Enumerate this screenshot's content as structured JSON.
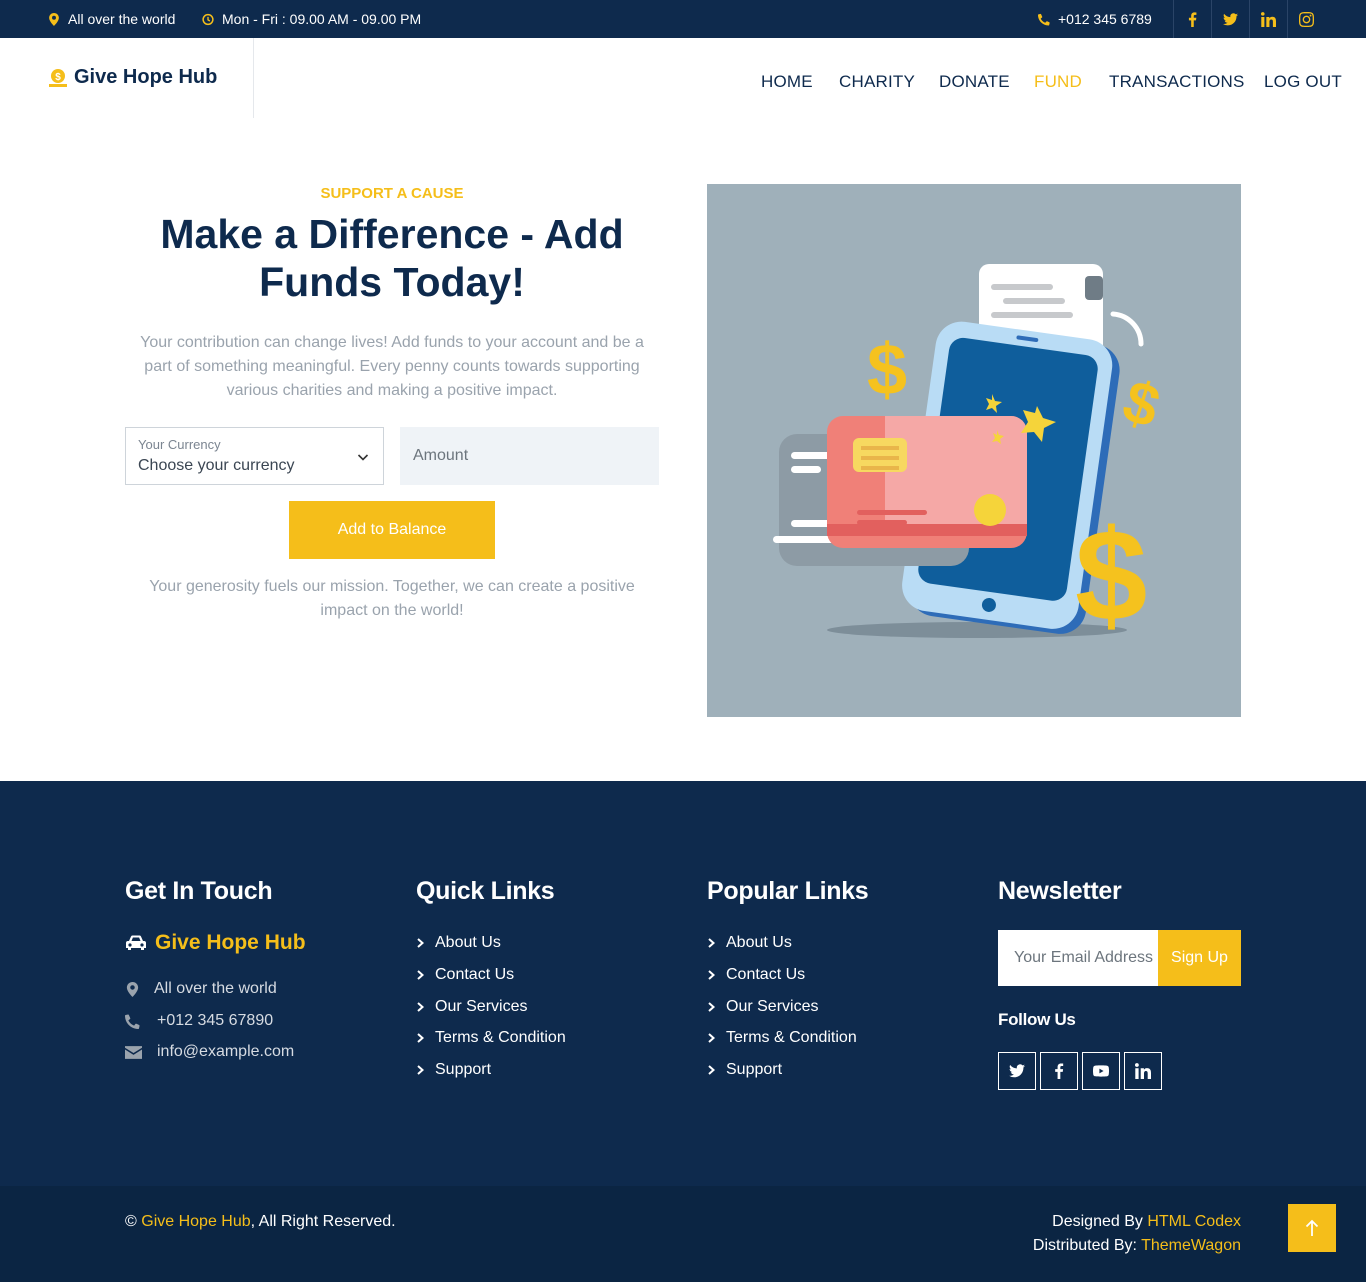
{
  "topbar": {
    "location": "All over the world",
    "hours": "Mon - Fri : 09.00 AM - 09.00 PM",
    "phone": "+012 345 6789",
    "social_icons": [
      "facebook-icon",
      "twitter-icon",
      "linkedin-icon",
      "instagram-icon"
    ]
  },
  "nav": {
    "brand": "Give Hope Hub",
    "items": [
      "HOME",
      "CHARITY",
      "DONATE",
      "FUND",
      "TRANSACTIONS",
      "LOG OUT"
    ],
    "active": "FUND"
  },
  "hero": {
    "eyebrow": "SUPPORT A CAUSE",
    "title": "Make a Difference - Add Funds Today!",
    "lead": "Your contribution can change lives! Add funds to your account and be a part of something meaningful. Every penny counts towards supporting various charities and making a positive impact.",
    "currency_label": "Your Currency",
    "currency_value": "Choose your currency",
    "amount_placeholder": "Amount",
    "button": "Add to Balance",
    "closing": "Your generosity fuels our mission. Together, we can create a positive impact on the world!"
  },
  "footer": {
    "get_in_touch": {
      "heading": "Get In Touch",
      "brand": "Give Hope Hub",
      "address": "All over the world",
      "phone": "+012 345 67890",
      "email": "info@example.com"
    },
    "quick_links": {
      "heading": "Quick Links",
      "items": [
        "About Us",
        "Contact Us",
        "Our Services",
        "Terms & Condition",
        "Support"
      ]
    },
    "popular_links": {
      "heading": "Popular Links",
      "items": [
        "About Us",
        "Contact Us",
        "Our Services",
        "Terms & Condition",
        "Support"
      ]
    },
    "newsletter": {
      "heading": "Newsletter",
      "email_placeholder": "Your Email Address",
      "button": "Sign Up",
      "follow": "Follow Us",
      "social_icons": [
        "twitter-icon",
        "facebook-icon",
        "youtube-icon",
        "linkedin-icon"
      ]
    }
  },
  "copyright": {
    "symbol": "©",
    "brand": "Give Hope Hub",
    "rights": ", All Right Reserved.",
    "designed_by_label": "Designed By",
    "designed_by": "HTML Codex",
    "distributed_by_label": "Distributed By:",
    "distributed_by": "ThemeWagon"
  },
  "colors": {
    "navy": "#0e2a4d",
    "accent": "#f5be1a",
    "illustration_bg": "#9fb0ba"
  }
}
